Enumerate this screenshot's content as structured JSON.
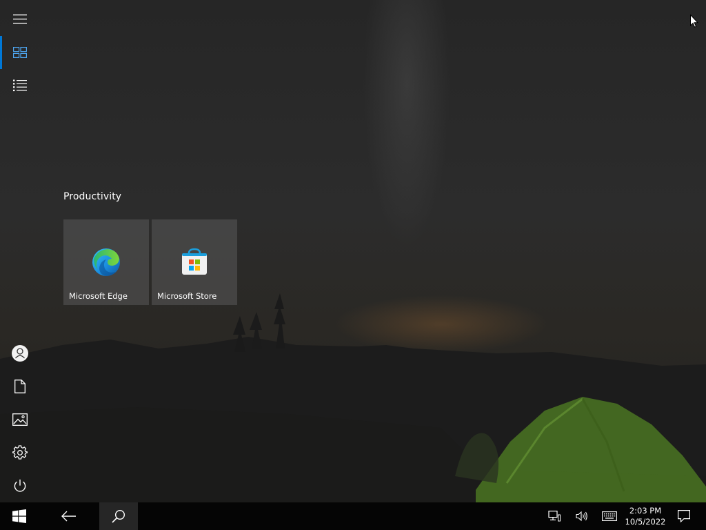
{
  "start_menu": {
    "rail": {
      "icons": [
        "hamburger-menu-icon",
        "all-tiles-icon",
        "app-list-icon",
        "user-account-icon",
        "documents-icon",
        "pictures-icon",
        "settings-gear-icon",
        "power-icon"
      ]
    },
    "group": {
      "title": "Productivity",
      "tiles": [
        {
          "label": "Microsoft Edge",
          "icon": "edge-icon"
        },
        {
          "label": "Microsoft Store",
          "icon": "store-icon"
        }
      ]
    }
  },
  "taskbar": {
    "clock": {
      "time": "2:03 PM",
      "date": "10/5/2022"
    },
    "icons": [
      "windows-start-icon",
      "back-arrow-icon",
      "search-icon",
      "network-icon",
      "volume-icon",
      "touch-keyboard-icon",
      "action-center-icon"
    ]
  },
  "colors": {
    "accent": "#0078d7",
    "taskbar": "#050505",
    "tile": "#4e4e4e",
    "tent": "#5a8a26"
  }
}
